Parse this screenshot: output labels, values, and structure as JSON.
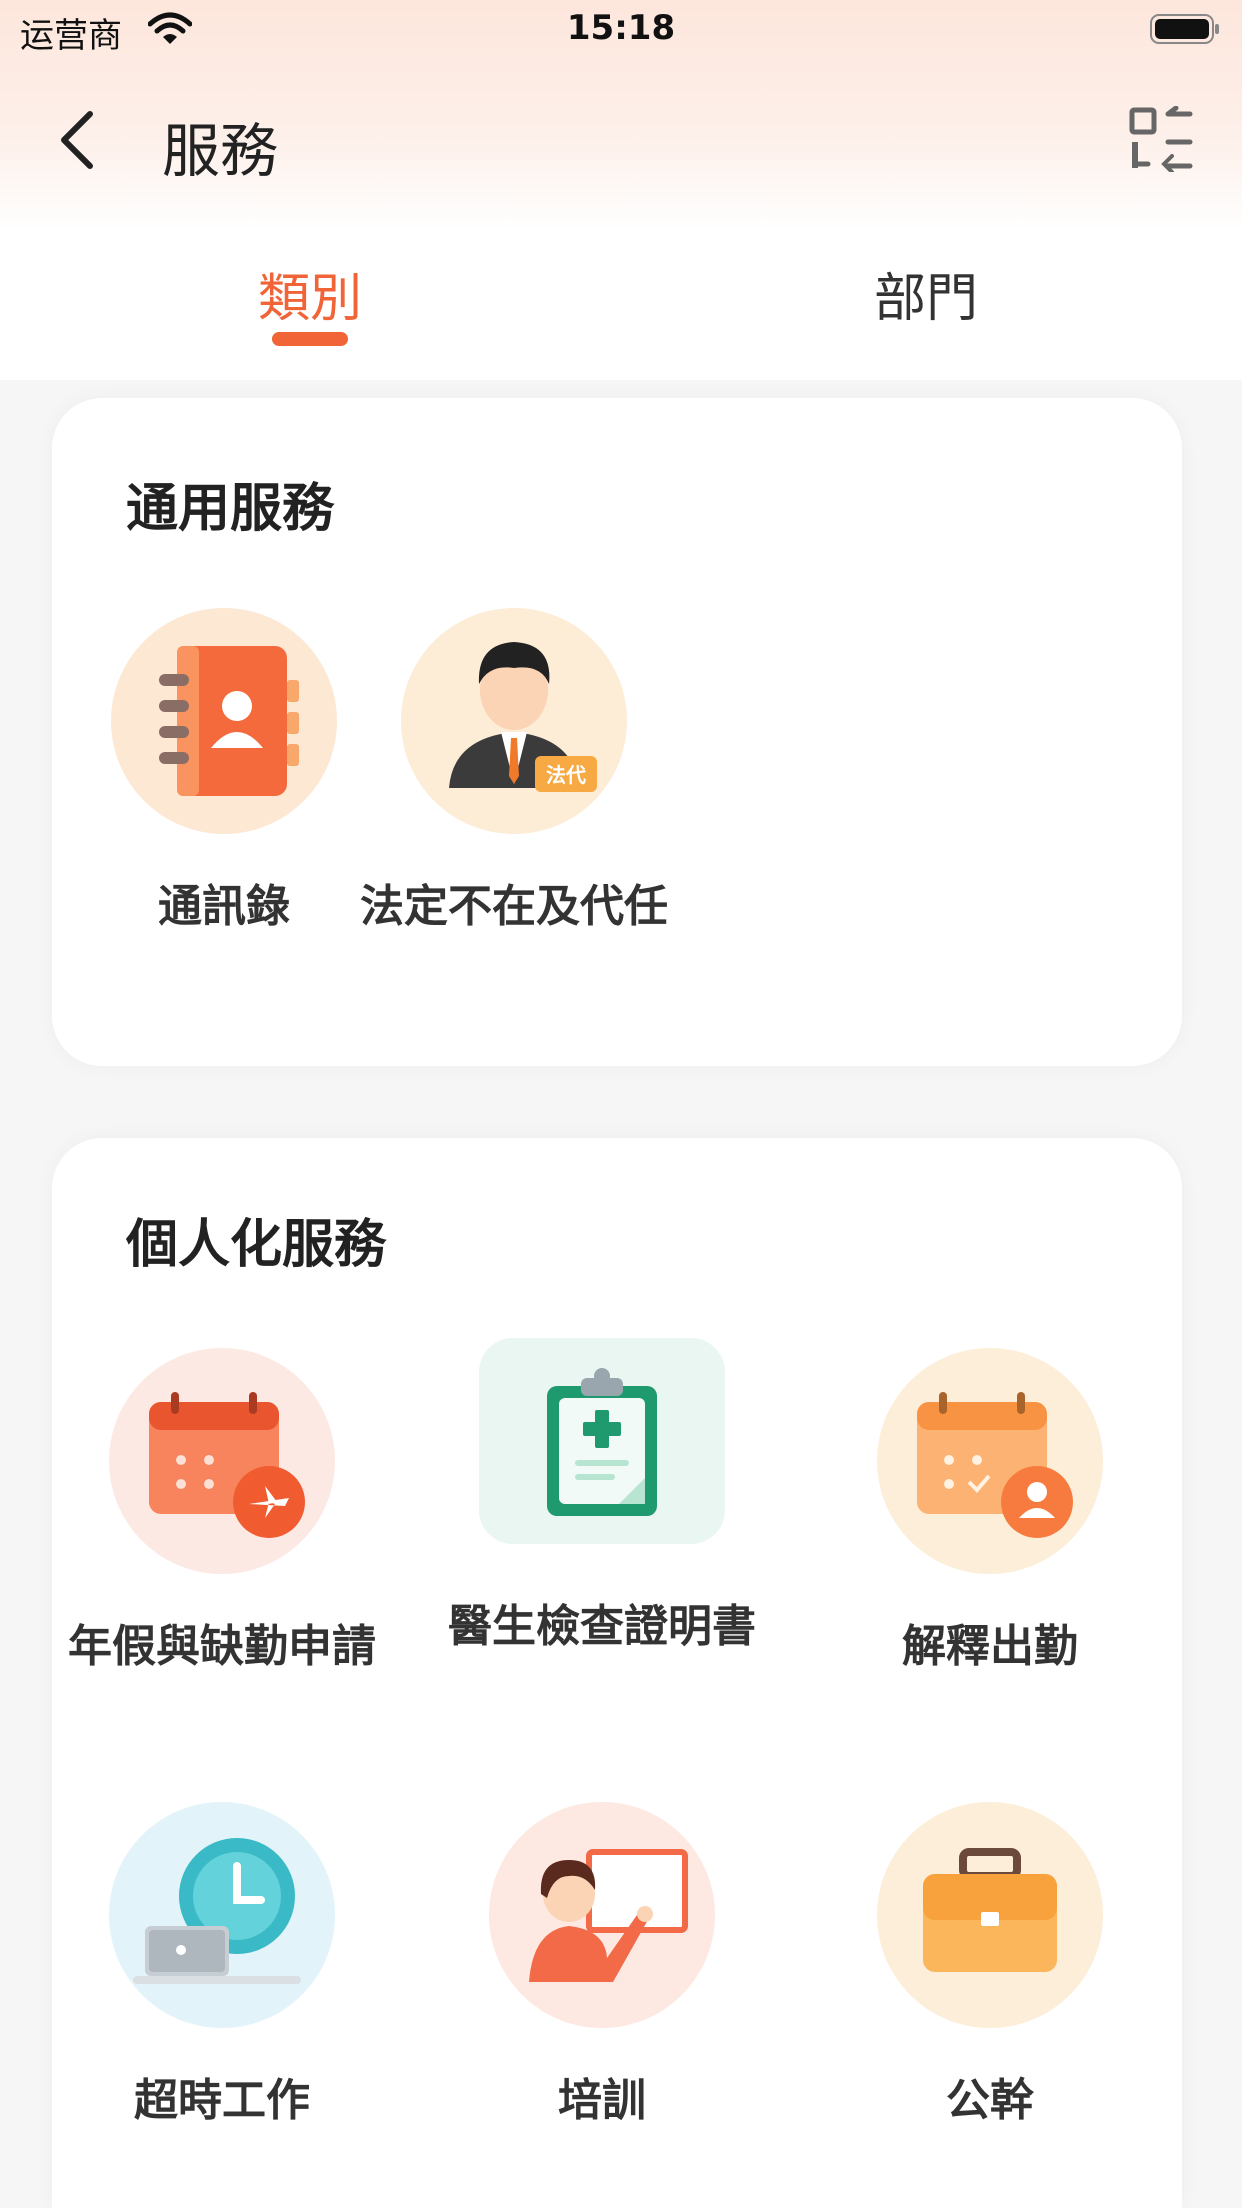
{
  "status_bar": {
    "carrier": "运营商",
    "time": "15:18"
  },
  "nav": {
    "title": "服務"
  },
  "tabs": [
    {
      "label": "類別",
      "active": true
    },
    {
      "label": "部門",
      "active": false
    }
  ],
  "sections": [
    {
      "title": "通用服務",
      "items": [
        {
          "label": "通訊錄",
          "icon": "address-book-icon"
        },
        {
          "label": "法定不在及代任",
          "icon": "acting-officer-icon",
          "badge": "法代"
        }
      ]
    },
    {
      "title": "個人化服務",
      "items": [
        {
          "label": "年假與缺勤申請",
          "icon": "leave-calendar-plane-icon"
        },
        {
          "label": "醫生檢查證明書",
          "icon": "medical-clipboard-icon"
        },
        {
          "label": "解釋出勤",
          "icon": "attendance-calendar-icon"
        },
        {
          "label": "超時工作",
          "icon": "overtime-clock-laptop-icon"
        },
        {
          "label": "培訓",
          "icon": "training-teacher-icon"
        },
        {
          "label": "公幹",
          "icon": "briefcase-icon"
        }
      ]
    }
  ],
  "colors": {
    "accent": "#f06437",
    "header_bg": "#fde6dc"
  }
}
